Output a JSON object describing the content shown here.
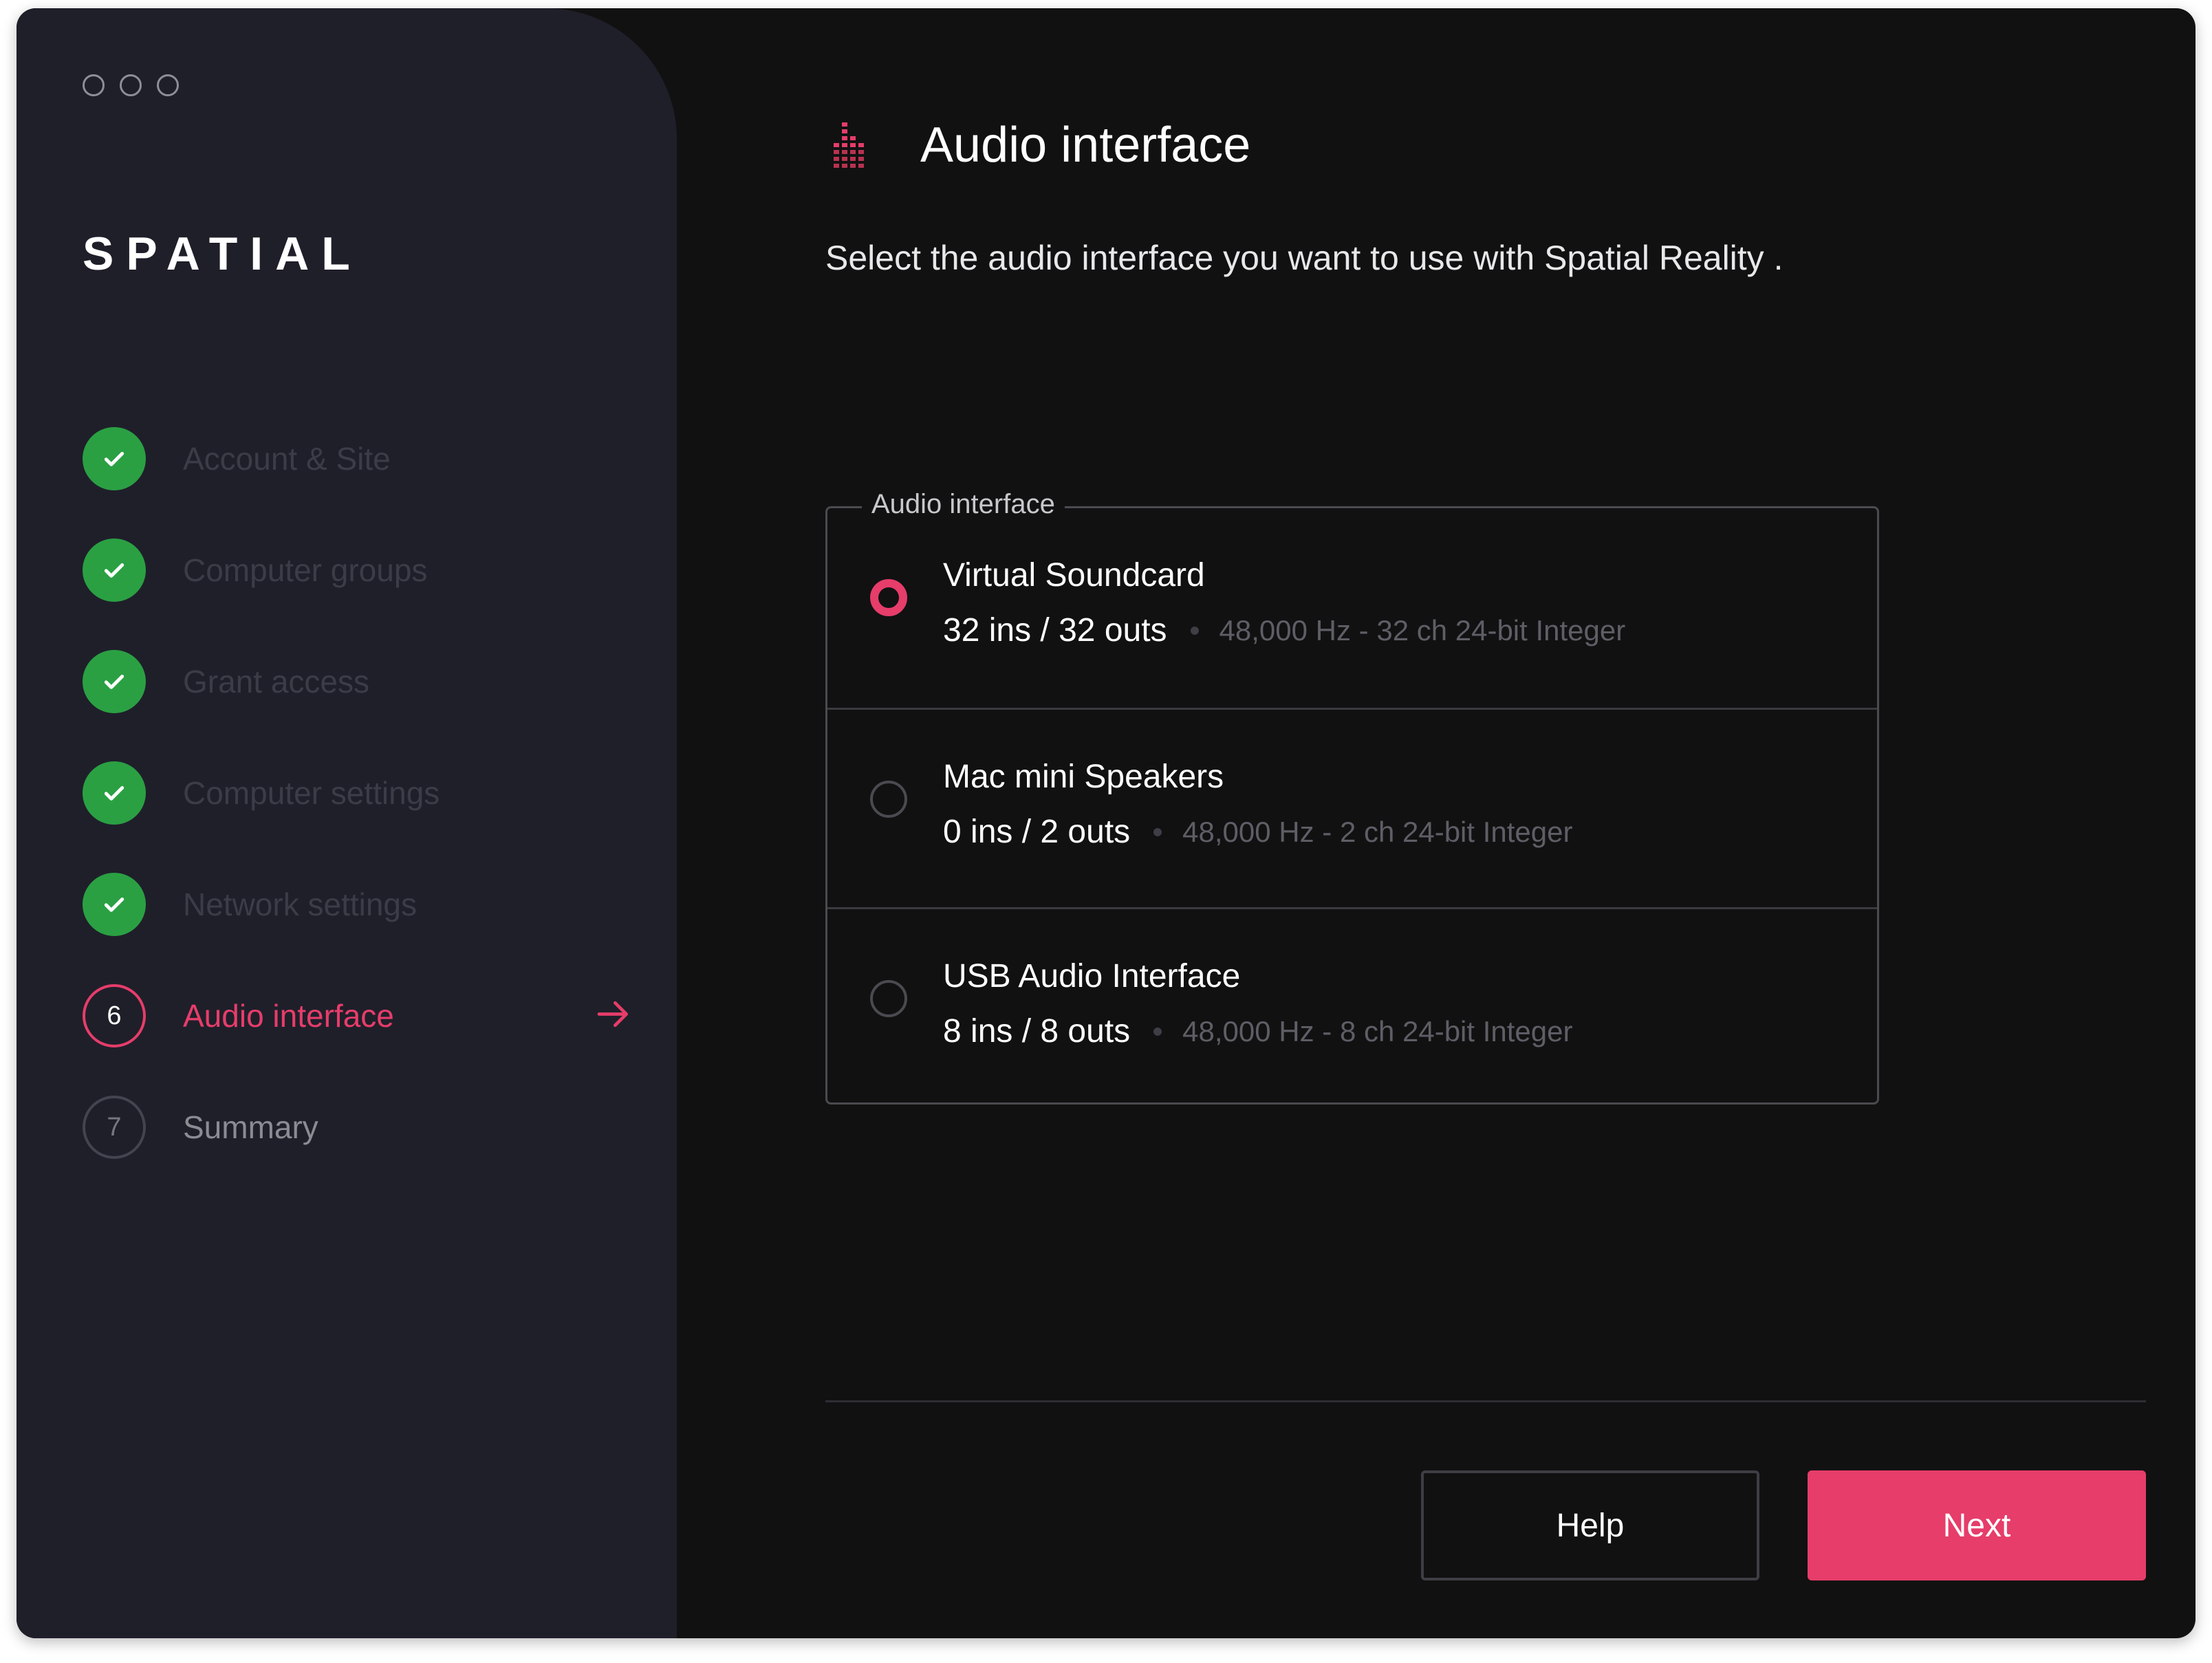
{
  "app": {
    "brand": "SPATIAL",
    "accent_color": "#e63d6a",
    "done_color": "#2aa043"
  },
  "sidebar": {
    "steps": [
      {
        "number": "1",
        "label": "Account & Site",
        "state": "done"
      },
      {
        "number": "2",
        "label": "Computer groups",
        "state": "done"
      },
      {
        "number": "3",
        "label": "Grant access",
        "state": "done"
      },
      {
        "number": "4",
        "label": "Computer settings",
        "state": "done"
      },
      {
        "number": "5",
        "label": "Network settings",
        "state": "done"
      },
      {
        "number": "6",
        "label": "Audio interface",
        "state": "active"
      },
      {
        "number": "7",
        "label": "Summary",
        "state": "pending"
      }
    ],
    "active_arrow_icon": "arrow-right-icon",
    "done_icon": "checkmark-icon"
  },
  "main": {
    "title": "Audio interface",
    "title_icon": "equalizer-icon",
    "subtitle": "Select the audio interface you want to use with Spatial Reality .",
    "group_label": "Audio interface",
    "options": [
      {
        "name": "Virtual Soundcard",
        "io": "32 ins / 32 outs",
        "spec": "48,000 Hz - 32 ch 24-bit Integer",
        "selected": true
      },
      {
        "name": "Mac mini Speakers",
        "io": "0 ins / 2 outs",
        "spec": "48,000 Hz - 2 ch 24-bit Integer",
        "selected": false
      },
      {
        "name": "USB Audio Interface",
        "io": "8 ins / 8 outs",
        "spec": "48,000 Hz - 8 ch 24-bit Integer",
        "selected": false
      }
    ]
  },
  "footer": {
    "help_label": "Help",
    "next_label": "Next"
  }
}
